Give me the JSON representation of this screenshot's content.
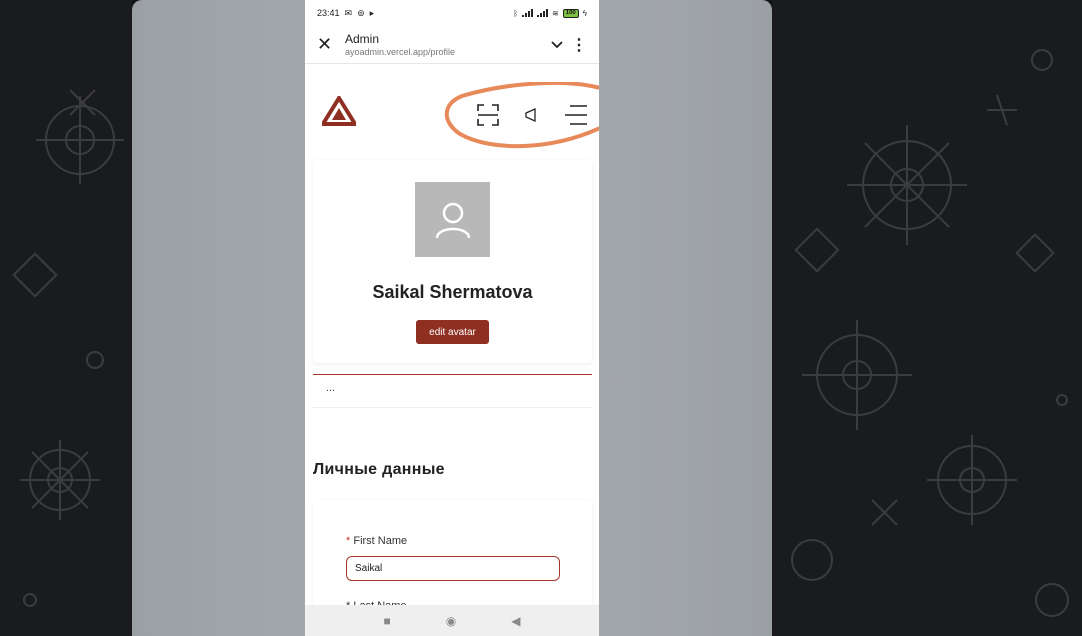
{
  "status_bar": {
    "time": "23:41",
    "battery": "100"
  },
  "browser": {
    "title": "Admin",
    "url": "ayoadmin.vercel.app/profile"
  },
  "header": {
    "logo": "logo-icon",
    "icons": [
      "scan-icon",
      "megaphone-icon",
      "menu-icon"
    ]
  },
  "profile": {
    "name": "Saikal Shermatova",
    "edit_avatar_label": "edit avatar",
    "tab_overflow": "..."
  },
  "personal": {
    "section_title": "Личные данные",
    "first_name_label": "First Name",
    "first_name_value": "Saikal",
    "last_name_label": "Last Name"
  },
  "colors": {
    "brand": "#8e2f22",
    "annotation": "#e8895a"
  }
}
